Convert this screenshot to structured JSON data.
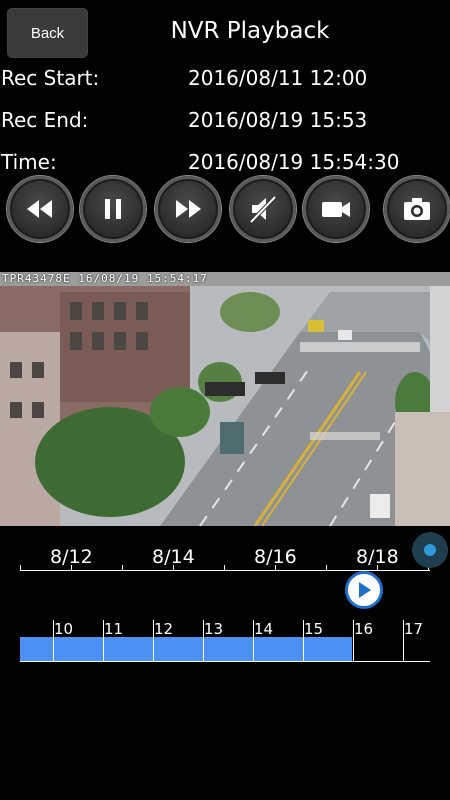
{
  "header": {
    "back_label": "Back",
    "title": "NVR Playback"
  },
  "info": {
    "rec_start_label": "Rec Start:",
    "rec_start_value": "2016/08/11 12:00",
    "rec_end_label": "Rec End:",
    "rec_end_value": "2016/08/19 15:53",
    "time_label": "Time:",
    "time_value": "2016/08/19 15:54:30"
  },
  "controls": [
    {
      "name": "rewind-button",
      "icon": "rewind-icon"
    },
    {
      "name": "pause-button",
      "icon": "pause-icon"
    },
    {
      "name": "fast-forward-button",
      "icon": "fast-forward-icon"
    },
    {
      "name": "mute-button",
      "icon": "speaker-muted-icon"
    },
    {
      "name": "record-button",
      "icon": "video-camera-icon"
    },
    {
      "name": "snapshot-button",
      "icon": "camera-icon"
    }
  ],
  "video": {
    "osd_text": "TPR43478E  16/08/19  15:54:17"
  },
  "date_timeline": {
    "labels": [
      "8/12",
      "8/14",
      "8/16",
      "8/18"
    ],
    "playhead_fraction": 0.84
  },
  "hour_timeline": {
    "labels": [
      "10",
      "11",
      "12",
      "13",
      "14",
      "15",
      "16",
      "17"
    ],
    "recorded_fraction": 0.81
  },
  "colors": {
    "accent": "#4a90f5",
    "knob": "#2e9bd8",
    "background": "#000000"
  }
}
